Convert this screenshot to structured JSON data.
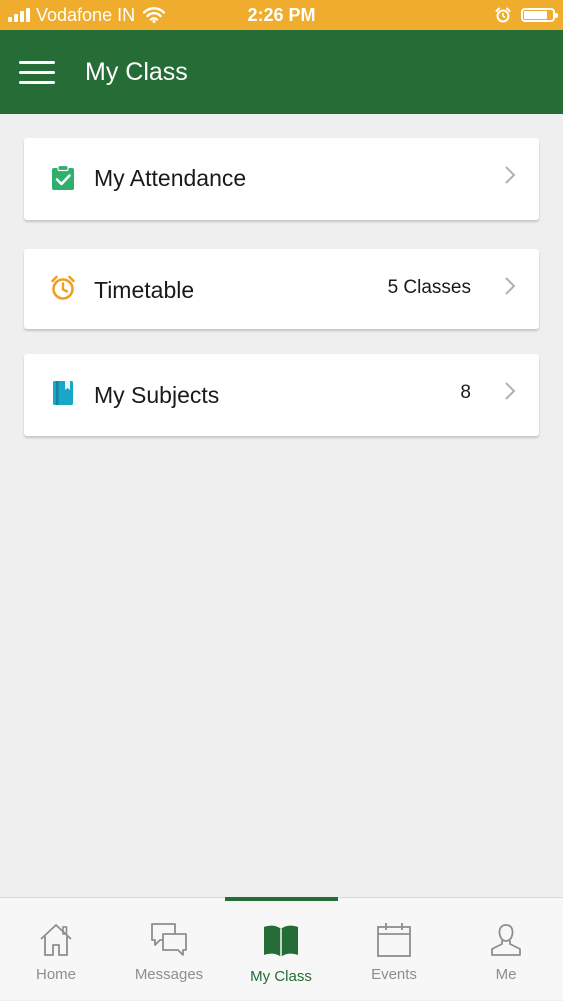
{
  "status_bar": {
    "carrier": "Vodafone IN",
    "time": "2:26 PM",
    "signal_bars": 4,
    "battery_level": 0.9,
    "icons": [
      "signal-icon",
      "wifi-icon",
      "alarm-icon",
      "battery-icon"
    ]
  },
  "app_bar": {
    "title": "My Class",
    "menu_icon": "hamburger-menu-icon",
    "background": "#256c36"
  },
  "cards": [
    {
      "label": "My Attendance",
      "meta": "",
      "icon": "clipboard-check-icon",
      "icon_color": "#2eaf6c"
    },
    {
      "label": "Timetable",
      "meta": "5 Classes",
      "icon": "alarm-clock-icon",
      "icon_color": "#f0a020"
    },
    {
      "label": "My Subjects",
      "meta": "8",
      "icon": "book-icon",
      "icon_color": "#1aa6c6"
    }
  ],
  "tabs": [
    {
      "label": "Home",
      "icon": "home-icon",
      "active": false
    },
    {
      "label": "Messages",
      "icon": "messages-icon",
      "active": false
    },
    {
      "label": "My Class",
      "icon": "open-book-icon",
      "active": true
    },
    {
      "label": "Events",
      "icon": "calendar-icon",
      "active": false
    },
    {
      "label": "Me",
      "icon": "user-icon",
      "active": false
    }
  ],
  "colors": {
    "status_bar": "#f0ac2c",
    "accent": "#256c36",
    "background": "#efeff0",
    "inactive_tab": "#8e8e8e"
  }
}
